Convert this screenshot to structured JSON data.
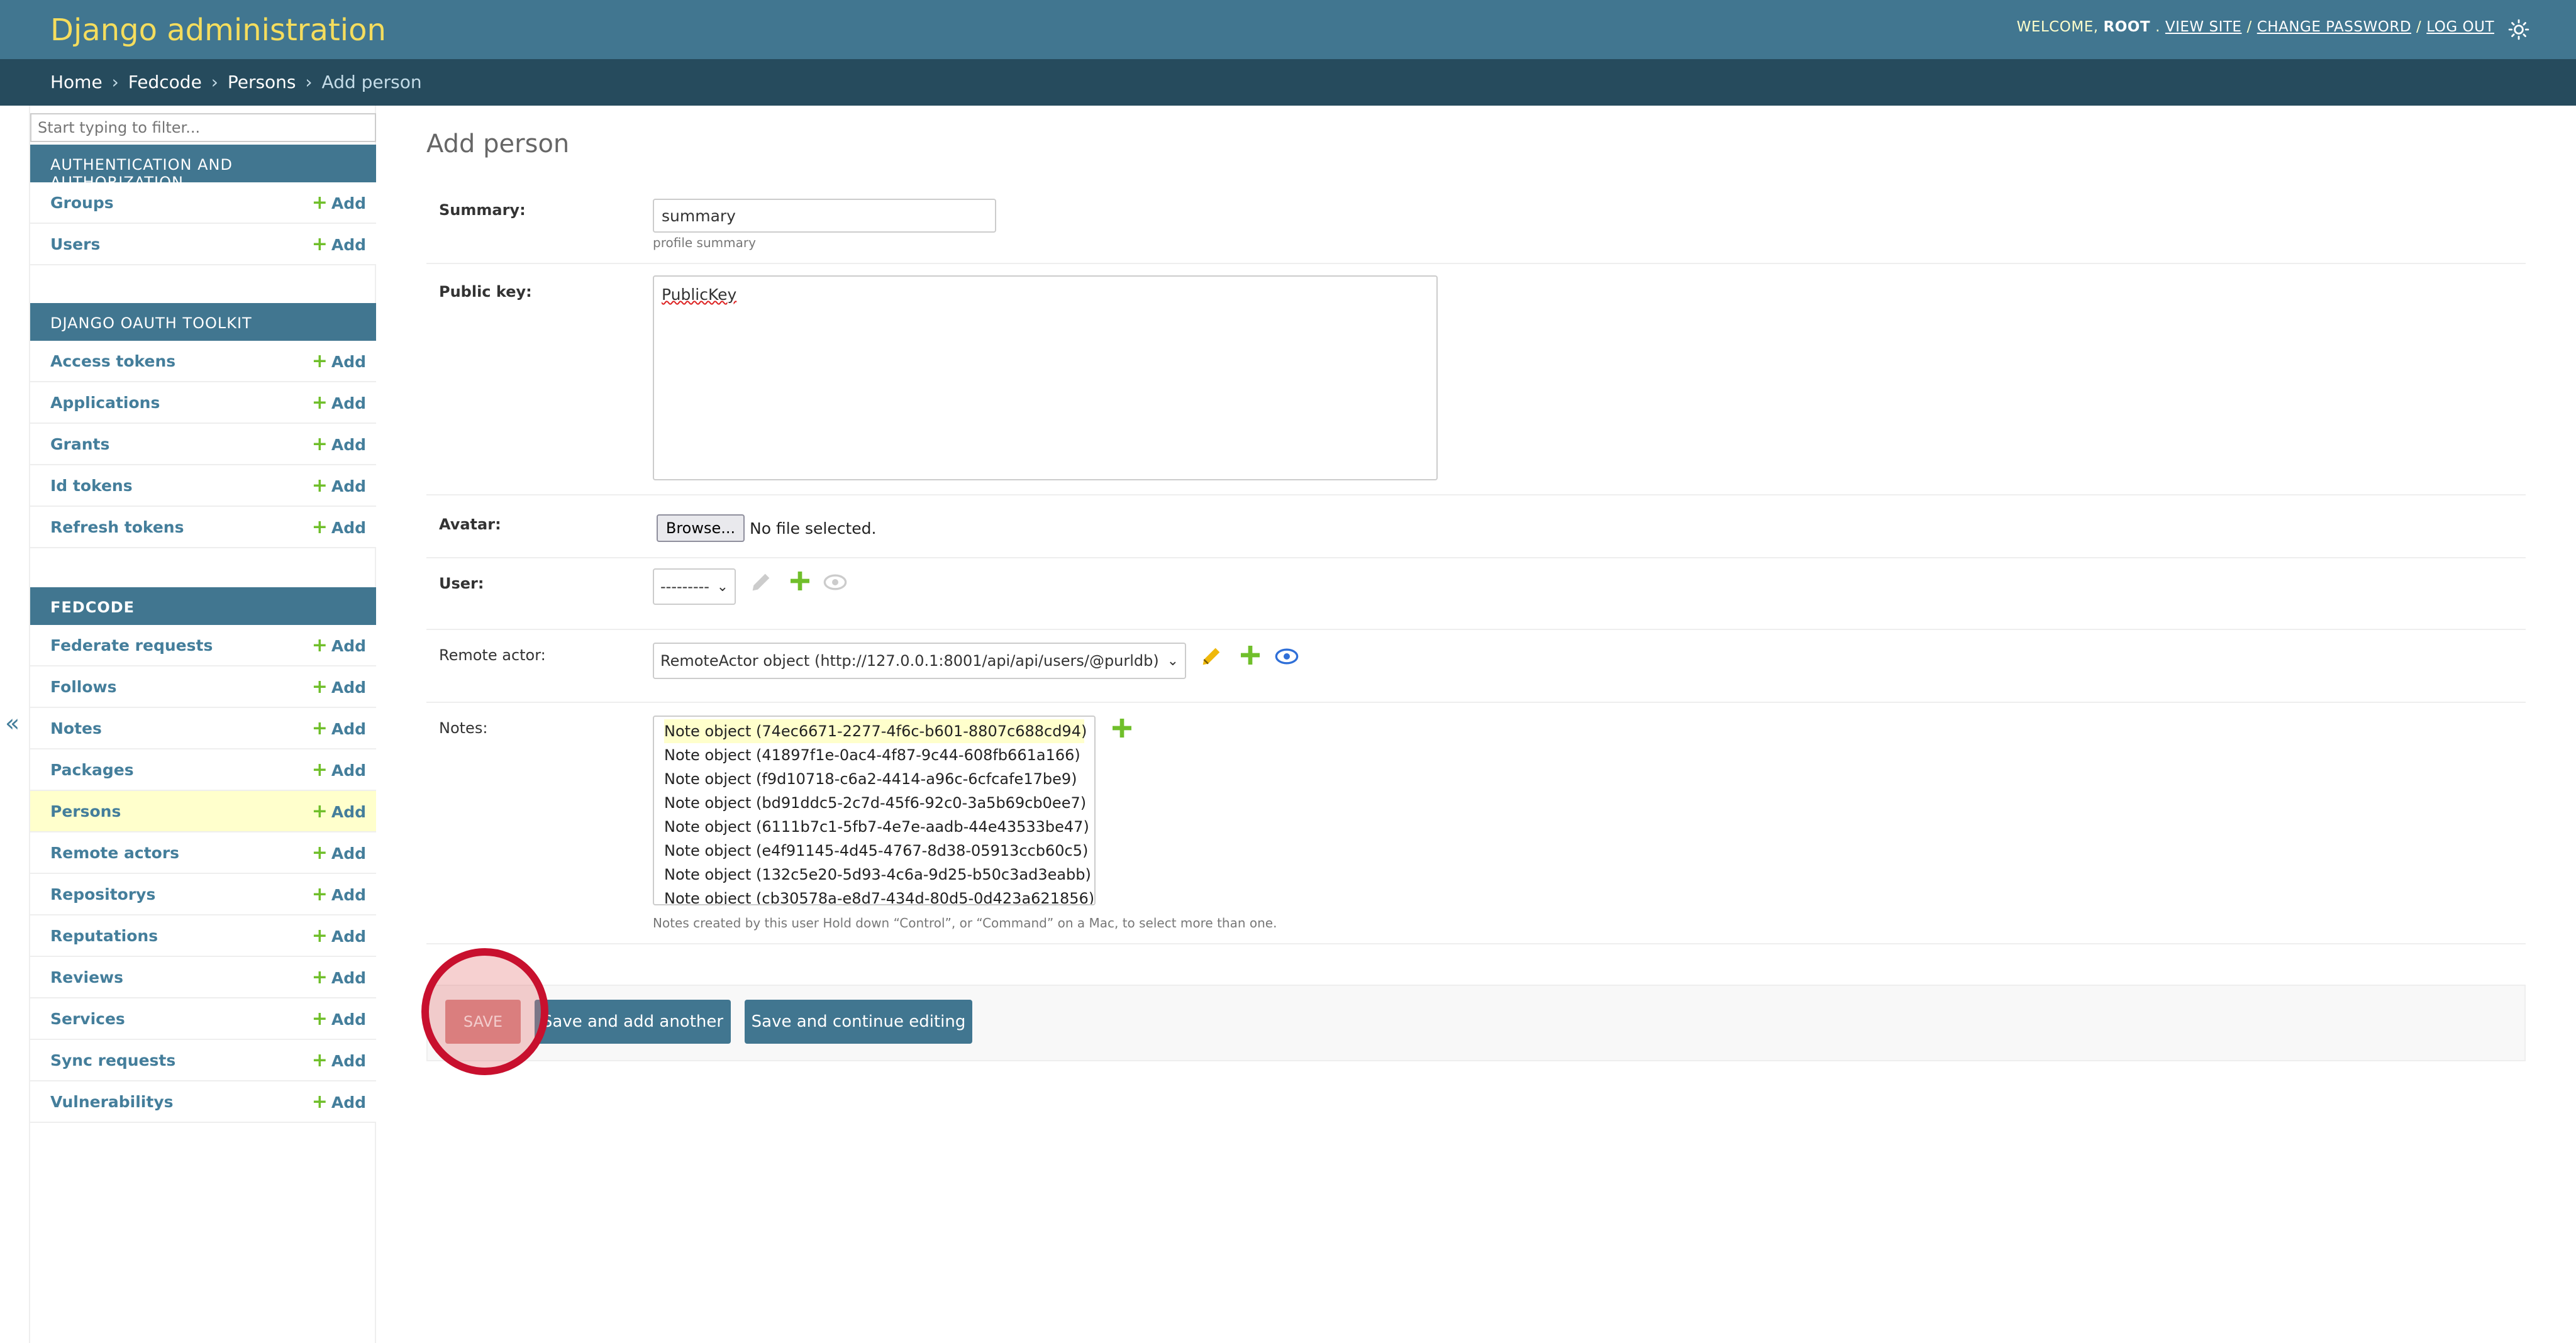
{
  "header": {
    "site_name": "Django administration",
    "welcome": "WELCOME,",
    "user": "ROOT",
    "view_site": "VIEW SITE",
    "change_password": "CHANGE PASSWORD",
    "log_out": "LOG OUT",
    "sep": "/",
    "theme_icon": "sun-icon"
  },
  "breadcrumbs": {
    "home": "Home",
    "app": "Fedcode",
    "model": "Persons",
    "current": "Add person",
    "sep": "›"
  },
  "sidebar": {
    "filter_placeholder": "Start typing to filter...",
    "add_label": "Add",
    "collapse": "«",
    "modules": [
      {
        "caption": "Authentication and Authorization",
        "rows": [
          "Groups",
          "Users"
        ]
      },
      {
        "caption": "Django OAuth Toolkit",
        "rows": [
          "Access tokens",
          "Applications",
          "Grants",
          "Id tokens",
          "Refresh tokens"
        ]
      },
      {
        "caption": "Fedcode",
        "rows": [
          "Federate requests",
          "Follows",
          "Notes",
          "Packages",
          "Persons",
          "Remote actors",
          "Repositorys",
          "Reputations",
          "Reviews",
          "Services",
          "Sync requests",
          "Vulnerabilitys"
        ],
        "selected": "Persons"
      }
    ]
  },
  "form": {
    "title": "Add person",
    "summary": {
      "label": "Summary:",
      "value": "summary",
      "help": "profile summary"
    },
    "public_key": {
      "label": "Public key:",
      "value": "PublicKey"
    },
    "avatar": {
      "label": "Avatar:",
      "button": "Browse...",
      "status": "No file selected."
    },
    "user": {
      "label": "User:",
      "value": "---------"
    },
    "remote_actor": {
      "label": "Remote actor:",
      "value": "RemoteActor object (http://127.0.0.1:8001/api/api/users/@purldb)"
    },
    "notes": {
      "label": "Notes:",
      "options": [
        "Note object (74ec6671-2277-4f6c-b601-8807c688cd94)",
        "Note object (41897f1e-0ac4-4f87-9c44-608fb661a166)",
        "Note object (f9d10718-c6a2-4414-a96c-6cfcafe17be9)",
        "Note object (bd91ddc5-2c7d-45f6-92c0-3a5b69cb0ee7)",
        "Note object (6111b7c1-5fb7-4e7e-aadb-44e43533be47)",
        "Note object (e4f91145-4d45-4767-8d38-05913ccb60c5)",
        "Note object (132c5e20-5d93-4c6a-9d25-b50c3ad3eabb)",
        "Note object (cb30578a-e8d7-434d-80d5-0d423a621856)"
      ],
      "help": "Notes created by this user Hold down “Control”, or “Command” on a Mac, to select more than one."
    }
  },
  "submit": {
    "save": "SAVE",
    "save_add_another": "Save and add another",
    "save_continue": "Save and continue editing"
  },
  "colors": {
    "header_bg": "#417690",
    "breadcrumbs_bg": "#264b5d",
    "site_name": "#f5dd5d",
    "add_plus": "#70bf2b",
    "selected_row": "#ffffcc",
    "highlight_circle": "#c8102e"
  }
}
